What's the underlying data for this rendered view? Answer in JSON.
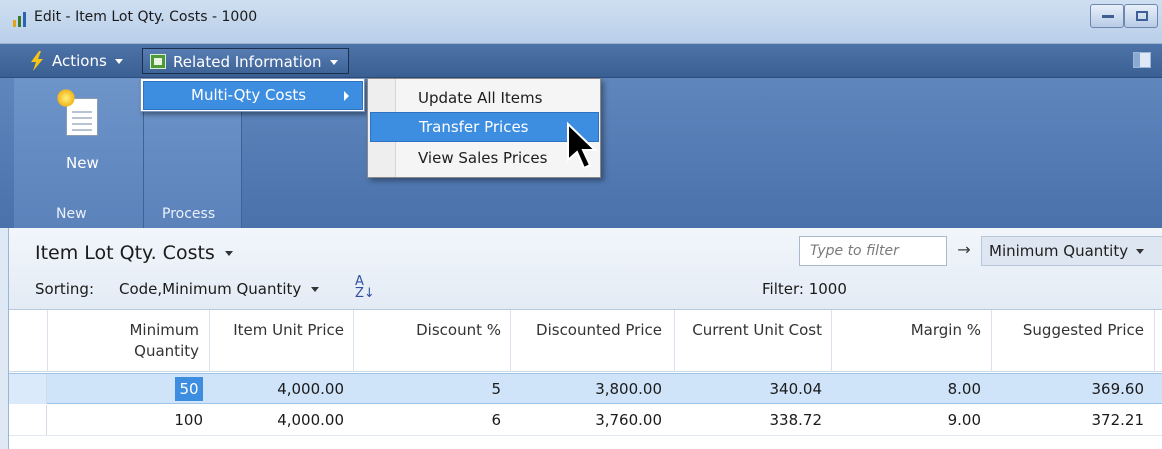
{
  "window": {
    "title": "Edit - Item Lot Qty. Costs - 1000"
  },
  "commandbar": {
    "actions_label": "Actions",
    "related_label": "Related Information"
  },
  "ribbon": {
    "new_button_label": "New",
    "group_new_label": "New",
    "group_process_label": "Process"
  },
  "menus": {
    "submenu_parent": "Multi-Qty Costs",
    "items": [
      "Update All Items",
      "Transfer Prices",
      "View Sales Prices"
    ],
    "highlighted": "Transfer Prices"
  },
  "list": {
    "title": "Item Lot Qty. Costs",
    "filter_placeholder": "Type to filter",
    "filter_field": "Minimum Quantity",
    "sorting_label": "Sorting:",
    "sorting_value": "Code,Minimum Quantity",
    "filter_text": "Filter: 1000",
    "columns": [
      {
        "line1": "Minimum",
        "line2": "Quantity"
      },
      {
        "line1": "Item Unit Price",
        "line2": ""
      },
      {
        "line1": "Discount %",
        "line2": ""
      },
      {
        "line1": "Discounted Price",
        "line2": ""
      },
      {
        "line1": "Current Unit Cost",
        "line2": ""
      },
      {
        "line1": "Margin %",
        "line2": ""
      },
      {
        "line1": "Suggested Price",
        "line2": ""
      }
    ],
    "rows": [
      [
        "50",
        "4,000.00",
        "5",
        "3,800.00",
        "340.04",
        "8.00",
        "369.60"
      ],
      [
        "100",
        "4,000.00",
        "6",
        "3,760.00",
        "338.72",
        "9.00",
        "372.21"
      ]
    ]
  },
  "colors": {
    "accent": "#3d8ee0",
    "commandbar": "#3f6397"
  }
}
